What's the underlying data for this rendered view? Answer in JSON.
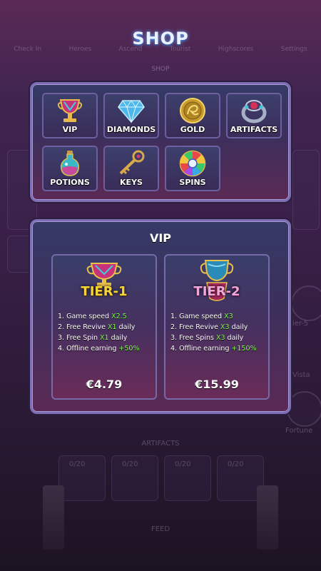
{
  "title": "SHOP",
  "background": {
    "top_tabs": [
      "Check In",
      "Heroes",
      "Ascend",
      "Tourist",
      "Highscores",
      "Settings"
    ],
    "shop_label": "SHOP",
    "artifacts_label": "ARTIFACTS",
    "counters": [
      "0/20",
      "0/20",
      "0/20",
      "0/20"
    ],
    "feed_label": "FEED",
    "right_labels": [
      "Tier-5",
      "Vista",
      "Fortune"
    ]
  },
  "categories": [
    {
      "label": "VIP",
      "icon": "trophy-icon"
    },
    {
      "label": "DIAMONDS",
      "icon": "diamond-icon"
    },
    {
      "label": "GOLD",
      "icon": "gold-coin-icon"
    },
    {
      "label": "ARTIFACTS",
      "icon": "ring-icon"
    },
    {
      "label": "POTIONS",
      "icon": "potion-icon"
    },
    {
      "label": "KEYS",
      "icon": "key-icon"
    },
    {
      "label": "SPINS",
      "icon": "spin-wheel-icon"
    }
  ],
  "vip": {
    "title": "VIP",
    "tiers": [
      {
        "name": "TIER-1",
        "perks": [
          {
            "text": "1. Game speed ",
            "value": "X2.5"
          },
          {
            "text": "2. Free Revive ",
            "value": "X1",
            "suffix": " daily"
          },
          {
            "text": "3. Free Spin ",
            "value": "X1",
            "suffix": " daily"
          },
          {
            "text": "4. Offline earning ",
            "value": "+50%"
          }
        ],
        "price": "€4.79"
      },
      {
        "name": "TIER-2",
        "perks": [
          {
            "text": "1. Game speed ",
            "value": "X3"
          },
          {
            "text": "2. Free Revive ",
            "value": "X3",
            "suffix": " daily"
          },
          {
            "text": "3. Free Spins ",
            "value": "X3",
            "suffix": " daily"
          },
          {
            "text": "4. Offline earning ",
            "value": "+150%"
          }
        ],
        "price": "€15.99"
      }
    ]
  },
  "colors": {
    "accent_green": "#7dff4a",
    "tier1_gold": "#f4d23a",
    "tier2_pink": "#e04a9a",
    "panel_border": "#7e6eb3"
  }
}
